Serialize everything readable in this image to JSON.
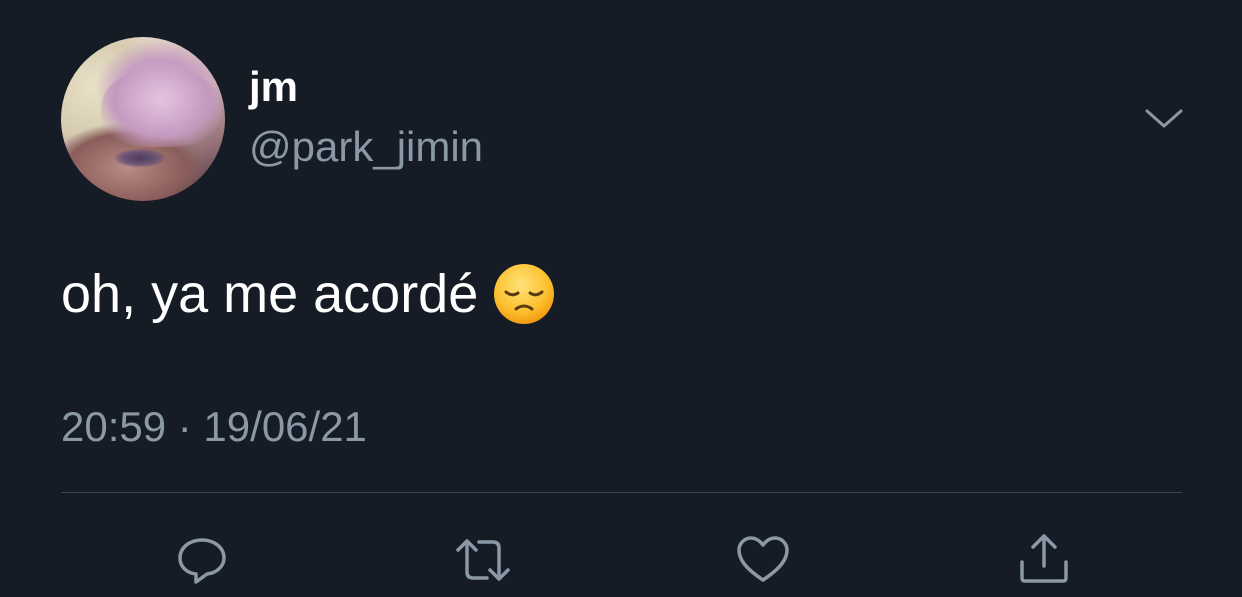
{
  "tweet": {
    "display_name": "jm",
    "handle": "@park_jimin",
    "text": "oh, ya me acordé",
    "emoji": "disappointed-face",
    "timestamp": "20:59 · 19/06/21"
  },
  "actions": [
    {
      "name": "reply",
      "icon": "reply-icon"
    },
    {
      "name": "retweet",
      "icon": "retweet-icon"
    },
    {
      "name": "like",
      "icon": "heart-icon"
    },
    {
      "name": "share",
      "icon": "share-icon"
    }
  ],
  "colors": {
    "background": "#161c26",
    "primary_text": "#ffffff",
    "secondary_text": "#8b98a5",
    "divider": "#38444d"
  }
}
